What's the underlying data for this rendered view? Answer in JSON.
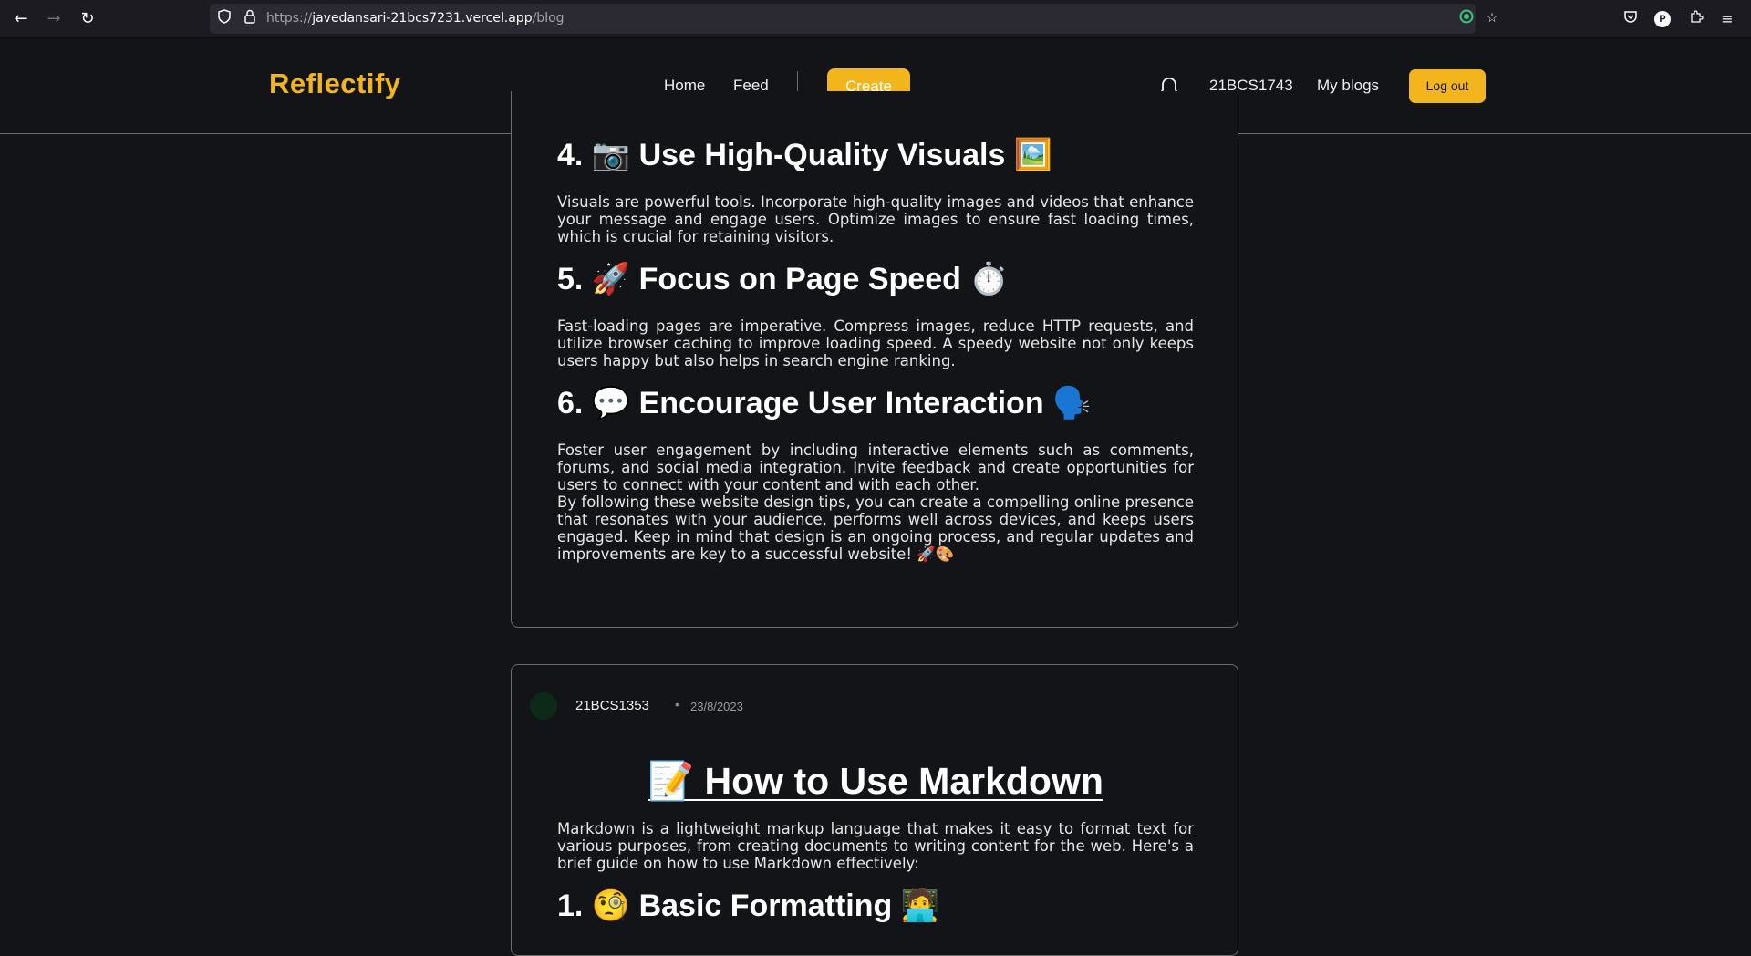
{
  "browser": {
    "url_prefix": "https://",
    "url_host": "javedansari-21bcs7231.vercel.app",
    "url_path": "/blog",
    "icons": [
      "back-icon",
      "forward-icon",
      "reload-icon",
      "shield-icon",
      "lock-icon",
      "extension-icon",
      "bookmark-star-icon",
      "pocket-icon",
      "profile-icon",
      "extensions-icon",
      "menu-icon"
    ],
    "profile_letter": "P"
  },
  "header": {
    "logo": "Reflectify",
    "nav": {
      "home": "Home",
      "feed": "Feed",
      "create": "Create"
    },
    "user": "21BCS1743",
    "my_blogs": "My blogs",
    "logout": "Log out",
    "accent": "#f2b51c"
  },
  "posts": [
    {
      "sections": [
        {
          "heading": "4. 📷 Use High-Quality Visuals 🖼️",
          "body": "Visuals are powerful tools. Incorporate high-quality images and videos that enhance your message and engage users. Optimize images to ensure fast loading times, which is crucial for retaining visitors."
        },
        {
          "heading": "5. 🚀 Focus on Page Speed ⏱️",
          "body": "Fast-loading pages are imperative. Compress images, reduce HTTP requests, and utilize browser caching to improve loading speed. A speedy website not only keeps users happy but also helps in search engine ranking."
        },
        {
          "heading": "6. 💬 Encourage User Interaction 🗣️",
          "body": "Foster user engagement by including interactive elements such as comments, forums, and social media integration. Invite feedback and create opportunities for users to connect with your content and with each other."
        }
      ],
      "closing": "By following these website design tips, you can create a compelling online presence that resonates with your audience, performs well across devices, and keeps users engaged. Keep in mind that design is an ongoing process, and regular updates and improvements are key to a successful website! 🚀🎨"
    },
    {
      "author": "21BCS1353",
      "separator": "•",
      "date": "23/8/2023",
      "title": "📝 How to Use Markdown",
      "intro": "Markdown is a lightweight markup language that makes it easy to format text for various purposes, from creating documents to writing content for the web. Here's a brief guide on how to use Markdown effectively:",
      "first_heading": "1. 🧐 Basic Formatting 🧑‍💻"
    }
  ]
}
